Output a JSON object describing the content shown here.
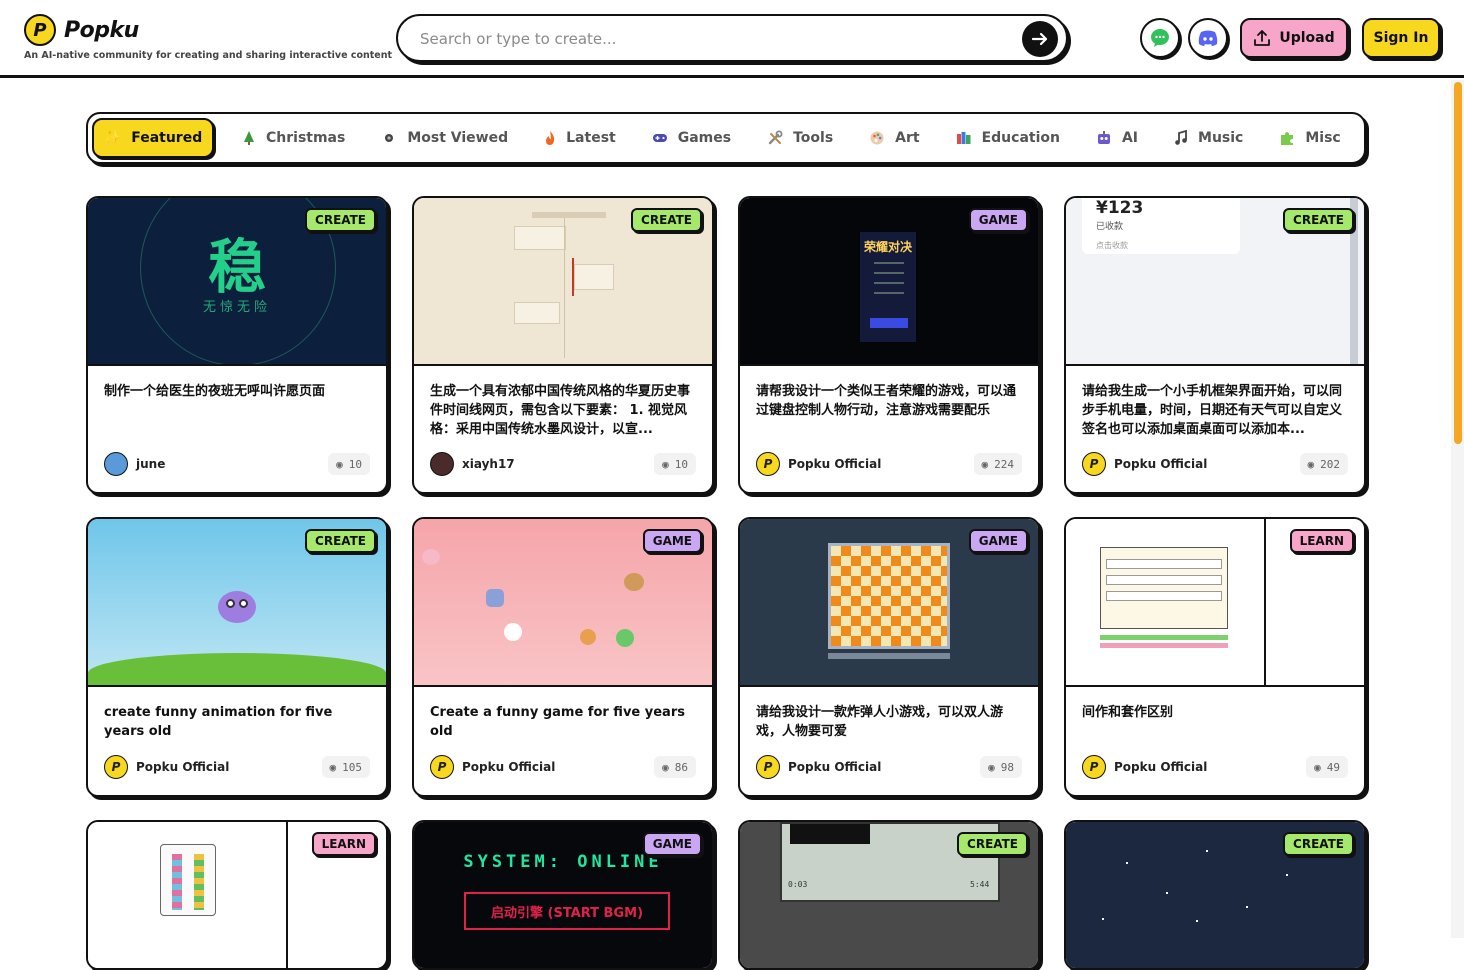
{
  "brand": {
    "name": "Popku",
    "logo_letter": "P",
    "tagline": "An AI-native community for creating and sharing interactive content"
  },
  "search": {
    "placeholder": "Search or type to create..."
  },
  "header": {
    "upload_label": "Upload",
    "signin_label": "Sign In"
  },
  "colors": {
    "yellow": "#f8d81f",
    "pink": "#f7a6c9",
    "green": "#a6e86c",
    "purple": "#c9a7f2",
    "scroll": "#f5a623"
  },
  "tabs": [
    {
      "label": "Featured",
      "icon": "sparkle-icon"
    },
    {
      "label": "Christmas",
      "icon": "tree-icon"
    },
    {
      "label": "Most Viewed",
      "icon": "eye-icon"
    },
    {
      "label": "Latest",
      "icon": "fire-icon"
    },
    {
      "label": "Games",
      "icon": "gamepad-icon"
    },
    {
      "label": "Tools",
      "icon": "tools-icon"
    },
    {
      "label": "Art",
      "icon": "palette-icon"
    },
    {
      "label": "Education",
      "icon": "books-icon"
    },
    {
      "label": "AI",
      "icon": "robot-icon"
    },
    {
      "label": "Music",
      "icon": "music-icon"
    },
    {
      "label": "Misc",
      "icon": "puzzle-icon"
    }
  ],
  "cards": [
    {
      "badge": "CREATE",
      "title": "制作一个给医生的夜班无呼叫许愿页面",
      "author": "june",
      "views": "10",
      "thumb_big": "稳",
      "thumb_small": "无惊无险"
    },
    {
      "badge": "CREATE",
      "title": "生成一个具有浓郁中国传统风格的华夏历史事件时间线网页，需包含以下要素： 1. 视觉风格：采用中国传统水墨风设计，以宣...",
      "author": "xiayh17",
      "views": "10"
    },
    {
      "badge": "GAME",
      "title": "请帮我设计一个类似王者荣耀的游戏，可以通过键盘控制人物行动，注意游戏需要配乐",
      "author": "Popku Official",
      "views": "224",
      "thumb_big": "荣耀对决"
    },
    {
      "badge": "CREATE",
      "title": "请给我生成一个小手机框架界面开始，可以同步手机电量，时间，日期还有天气可以自定义签名也可以添加桌面桌面可以添加本...",
      "author": "Popku Official",
      "views": "202",
      "thumb_big": "¥123",
      "thumb_small": "已收款",
      "thumb_tiny": "点击收款"
    },
    {
      "badge": "CREATE",
      "title": "create funny animation for five years old",
      "author": "Popku Official",
      "views": "105"
    },
    {
      "badge": "GAME",
      "title": "Create a funny game for five years old",
      "author": "Popku Official",
      "views": "86"
    },
    {
      "badge": "GAME",
      "title": "请给我设计一款炸弹人小游戏，可以双人游戏，人物要可爱",
      "author": "Popku Official",
      "views": "98"
    },
    {
      "badge": "LEARN",
      "title": "间作和套作区别",
      "author": "Popku Official",
      "views": "49"
    },
    {
      "badge": "LEARN"
    },
    {
      "badge": "GAME",
      "thumb_big": "SYSTEM: ONLINE",
      "thumb_small": "启动引擎 (START BGM)"
    },
    {
      "badge": "CREATE",
      "thumb_small": "0:03",
      "thumb_tiny": "5:44"
    },
    {
      "badge": "CREATE"
    }
  ]
}
